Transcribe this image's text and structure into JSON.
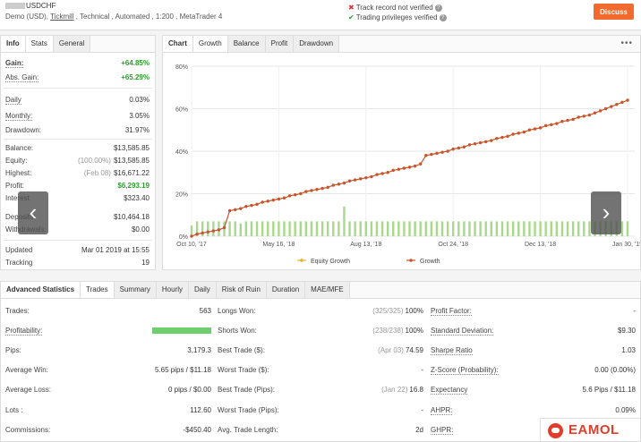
{
  "header": {
    "title": "USDCHF",
    "subtitle_pre": "Demo (USD), ",
    "broker": "Tickmill",
    "subtitle_post": " , Technical , Automated , 1:200 , MetaTrader 4",
    "check1": "Track record not verified",
    "check2": "Trading privileges verified",
    "discuss": "Discuss"
  },
  "left_tabs": [
    "Info",
    "Stats",
    "General"
  ],
  "stats": {
    "gain_label": "Gain:",
    "gain_value": "+64.85%",
    "abs_gain_label": "Abs. Gain:",
    "abs_gain_value": "+65.29%",
    "daily_label": "Daily",
    "daily_value": "0.03%",
    "monthly_label": "Monthly:",
    "monthly_value": "3.05%",
    "drawdown_label": "Drawdown:",
    "drawdown_value": "31.97%",
    "balance_label": "Balance:",
    "balance_value": "$13,585.85",
    "equity_label": "Equity:",
    "equity_note": "(100.00%)",
    "equity_value": "$13,585.85",
    "highest_label": "Highest:",
    "highest_note": "(Feb 08)",
    "highest_value": "$16,671.22",
    "profit_label": "Profit:",
    "profit_value": "$6,293.19",
    "interest_label": "Interest",
    "interest_value": "$323.40",
    "deposits_label": "Deposits:",
    "deposits_value": "$10,464.18",
    "withdrawals_label": "Withdrawals:",
    "withdrawals_value": "$0.00",
    "updated_label": "Updated",
    "updated_value": "Mar 01 2019 at 15:55",
    "tracking_label": "Tracking",
    "tracking_value": "19"
  },
  "chart_tabs": [
    "Chart",
    "Growth",
    "Balance",
    "Profit",
    "Drawdown"
  ],
  "chart_menu": "•••",
  "chart_data": {
    "type": "line",
    "x_ticks": [
      "Oct 10, '17",
      "May 16, '18",
      "Aug 13, '18",
      "Oct 24, '18",
      "Dec 13, '18",
      "Jan 30, '19"
    ],
    "y_ticks": [
      "0%",
      "20%",
      "40%",
      "60%",
      "80%"
    ],
    "ylim": [
      0,
      80
    ],
    "series": [
      {
        "name": "Growth",
        "color": "#c8552b",
        "x": [
          0,
          1,
          2,
          3,
          4,
          5,
          6,
          7,
          8,
          9,
          10,
          11,
          12,
          13,
          14,
          15,
          16,
          17,
          18,
          19,
          20,
          21,
          22,
          23,
          24,
          25,
          26,
          27,
          28,
          29,
          30,
          31,
          32,
          33,
          34,
          35,
          36,
          37,
          38,
          39,
          40,
          41,
          42,
          43,
          44,
          45,
          46,
          47,
          48,
          49,
          50,
          51,
          52,
          53,
          54,
          55,
          56,
          57,
          58,
          59,
          60,
          61,
          62,
          63,
          64,
          65,
          66,
          67,
          68,
          69,
          70,
          71,
          72,
          73,
          74,
          75,
          76,
          77,
          78,
          79,
          80
        ],
        "values": [
          0,
          1,
          1.5,
          2,
          2.5,
          3,
          4,
          12,
          12.5,
          13,
          14,
          14.5,
          15,
          16,
          16.5,
          17,
          17.5,
          18,
          19,
          19.5,
          20,
          21,
          21.5,
          22,
          22.5,
          23,
          24,
          24.5,
          25,
          26,
          26.5,
          27,
          27.5,
          28,
          29,
          29.5,
          30,
          31,
          31.5,
          32,
          32.5,
          33,
          34,
          38,
          38.5,
          39,
          39.5,
          40,
          41,
          41.5,
          42,
          43,
          43.5,
          44,
          44.5,
          45,
          46,
          46.5,
          47,
          48,
          48.5,
          49,
          50,
          50.5,
          51,
          52,
          52.5,
          53,
          54,
          54.5,
          55,
          56,
          56.5,
          57,
          58,
          59,
          60,
          61,
          62,
          63,
          64
        ]
      },
      {
        "name": "Equity Growth",
        "color": "#e8b32c"
      }
    ],
    "bars": [
      5,
      7,
      7,
      7,
      7,
      7,
      7,
      7,
      7,
      6,
      7,
      7,
      7,
      7,
      7,
      7,
      7,
      7,
      7,
      7,
      7,
      7,
      7,
      7,
      7,
      7,
      7,
      7,
      14,
      7,
      7,
      7,
      7,
      7,
      7,
      7,
      7,
      7,
      7,
      7,
      7,
      7,
      7,
      7,
      7,
      7,
      7,
      7,
      7,
      7,
      7,
      7,
      7,
      7,
      7,
      7,
      7,
      7,
      7,
      7,
      7,
      7,
      7,
      7,
      7,
      7,
      7,
      7,
      7,
      7,
      7,
      7,
      7,
      7,
      7,
      7,
      7,
      7,
      7,
      7,
      7
    ],
    "bar_color": "#a8d98a"
  },
  "bottom_tabs": [
    "Advanced Statistics",
    "Trades",
    "Summary",
    "Hourly",
    "Daily",
    "Risk of Ruin",
    "Duration",
    "MAE/MFE"
  ],
  "adv": {
    "col1": [
      {
        "l": "Trades:",
        "r": "563"
      },
      {
        "l": "Profitability:",
        "r": ""
      },
      {
        "l": "Pips:",
        "r": "3,179.3"
      },
      {
        "l": "Average Win:",
        "r": "5.65 pips / $11.18"
      },
      {
        "l": "Average Loss:",
        "r": "0 pips / $0.00"
      },
      {
        "l": "Lots :",
        "r": "112.60"
      },
      {
        "l": "Commissions:",
        "r": "-$450.40"
      }
    ],
    "col2": [
      {
        "l": "Longs Won:",
        "n": "(325/325)",
        "r": "100%"
      },
      {
        "l": "Shorts Won:",
        "n": "(238/238)",
        "r": "100%"
      },
      {
        "l": "Best Trade ($):",
        "n": "(Apr 03)",
        "r": "74.59"
      },
      {
        "l": "Worst Trade ($):",
        "n": "",
        "r": "-"
      },
      {
        "l": "Best Trade (Pips):",
        "n": "(Jan 22)",
        "r": "16.8"
      },
      {
        "l": "Worst Trade (Pips):",
        "n": "",
        "r": "-"
      },
      {
        "l": "Avg. Trade Length:",
        "n": "",
        "r": "2d"
      }
    ],
    "col3": [
      {
        "l": "Profit Factor:",
        "r": "-"
      },
      {
        "l": "Standard Deviation:",
        "r": "$9.30"
      },
      {
        "l": "Sharpe Ratio",
        "r": "1.03"
      },
      {
        "l": "Z-Score (Probability):",
        "r": "0.00 (0.00%)"
      },
      {
        "l": "Expectancy",
        "r": "5.6 Pips / $11.18"
      },
      {
        "l": "AHPR:",
        "r": "0.09%"
      },
      {
        "l": "GHPR:",
        "r": ""
      }
    ]
  },
  "logo_text": "EAMOL"
}
